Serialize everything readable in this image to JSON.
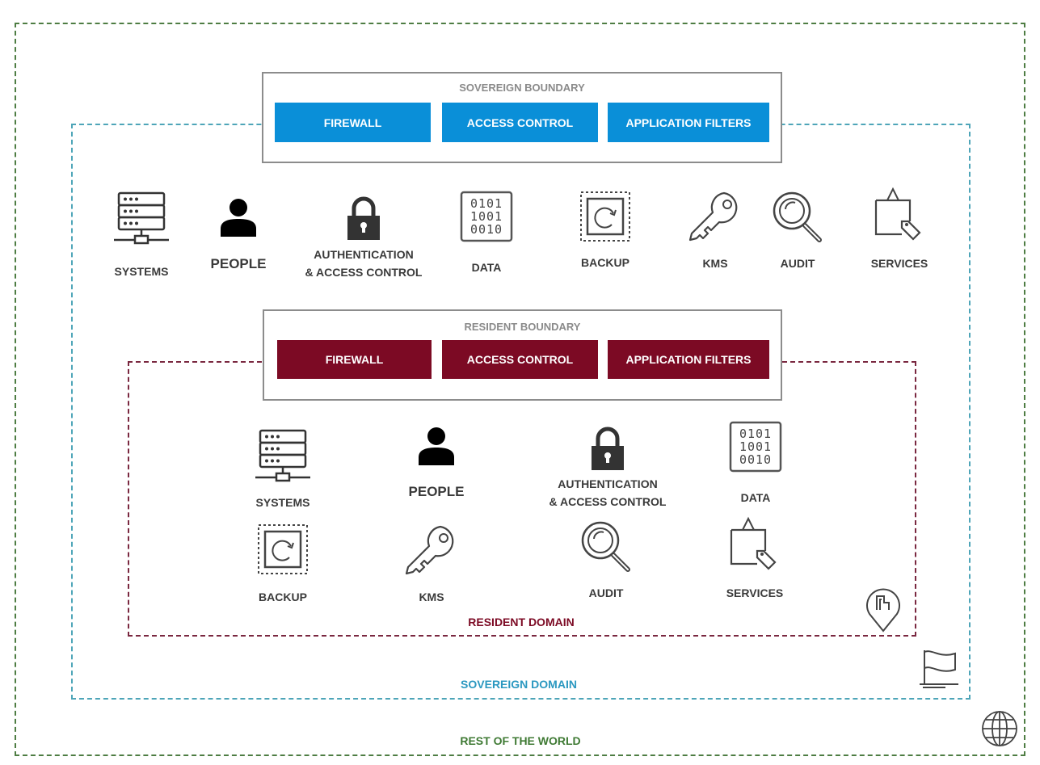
{
  "colors": {
    "sovereign_blue": "#0a8fd8",
    "resident_maroon": "#7c0a24",
    "sovereign_dash": "#4ea5b8",
    "resident_dash": "#7a2840",
    "world_dash": "#4e7d43",
    "text": "#3a3a3a"
  },
  "sovereign_boundary": {
    "title": "SOVEREIGN BOUNDARY",
    "buttons": [
      "FIREWALL",
      "ACCESS CONTROL",
      "APPLICATION FILTERS"
    ]
  },
  "resident_boundary": {
    "title": "RESIDENT BOUNDARY",
    "buttons": [
      "FIREWALL",
      "ACCESS CONTROL",
      "APPLICATION FILTERS"
    ]
  },
  "sovereign_items": [
    {
      "label": "SYSTEMS",
      "icon": "server-icon"
    },
    {
      "label": "PEOPLE",
      "icon": "person-icon"
    },
    {
      "label": "AUTHENTICATION\n& ACCESS CONTROL",
      "icon": "lock-icon"
    },
    {
      "label": "DATA",
      "icon": "binary-data-icon",
      "binary": [
        "0101",
        "1001",
        "0010"
      ]
    },
    {
      "label": "BACKUP",
      "icon": "backup-icon"
    },
    {
      "label": "KMS",
      "icon": "key-icon"
    },
    {
      "label": "AUDIT",
      "icon": "magnifier-icon"
    },
    {
      "label": "SERVICES",
      "icon": "shopping-bag-icon"
    }
  ],
  "resident_items": [
    {
      "label": "SYSTEMS",
      "icon": "server-icon"
    },
    {
      "label": "PEOPLE",
      "icon": "person-icon"
    },
    {
      "label": "AUTHENTICATION\n& ACCESS CONTROL",
      "icon": "lock-icon"
    },
    {
      "label": "DATA",
      "icon": "binary-data-icon",
      "binary": [
        "0101",
        "1001",
        "0010"
      ]
    },
    {
      "label": "BACKUP",
      "icon": "backup-icon"
    },
    {
      "label": "KMS",
      "icon": "key-icon"
    },
    {
      "label": "AUDIT",
      "icon": "magnifier-icon"
    },
    {
      "label": "SERVICES",
      "icon": "shopping-bag-icon"
    }
  ],
  "domains": {
    "resident": "RESIDENT DOMAIN",
    "sovereign": "SOVEREIGN DOMAIN",
    "world": "REST OF THE WORLD"
  },
  "corner_icons": [
    "location-pin-icon",
    "flag-icon",
    "globe-icon"
  ]
}
